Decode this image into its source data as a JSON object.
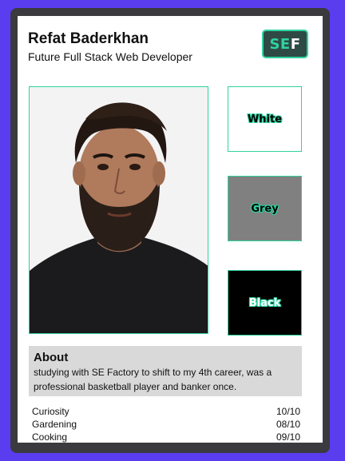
{
  "profile": {
    "name": "Refat Baderkhan",
    "title": "Future Full Stack Web Developer"
  },
  "logo": {
    "text_se": "SE",
    "text_f": "F",
    "accent": "#2ed3a0",
    "background": "#2f4a45"
  },
  "photo": {
    "icon": "portrait-photo"
  },
  "swatches": [
    {
      "label": "White",
      "color": "#ffffff"
    },
    {
      "label": "Grey",
      "color": "#808080"
    },
    {
      "label": "Black",
      "color": "#000000"
    }
  ],
  "about": {
    "title": "About",
    "text": "studying with SE Factory to shift to my 4th career, was a professional basketball player and banker once."
  },
  "hobbies": [
    {
      "name": "Curiosity",
      "score": "10/10"
    },
    {
      "name": "Gardening",
      "score": "08/10"
    },
    {
      "name": "Cooking",
      "score": "09/10"
    }
  ],
  "colors": {
    "page_background": "#5b3df0",
    "frame": "#3a3a3f",
    "accent": "#2ed3a0",
    "about_background": "#d9d9d9"
  }
}
